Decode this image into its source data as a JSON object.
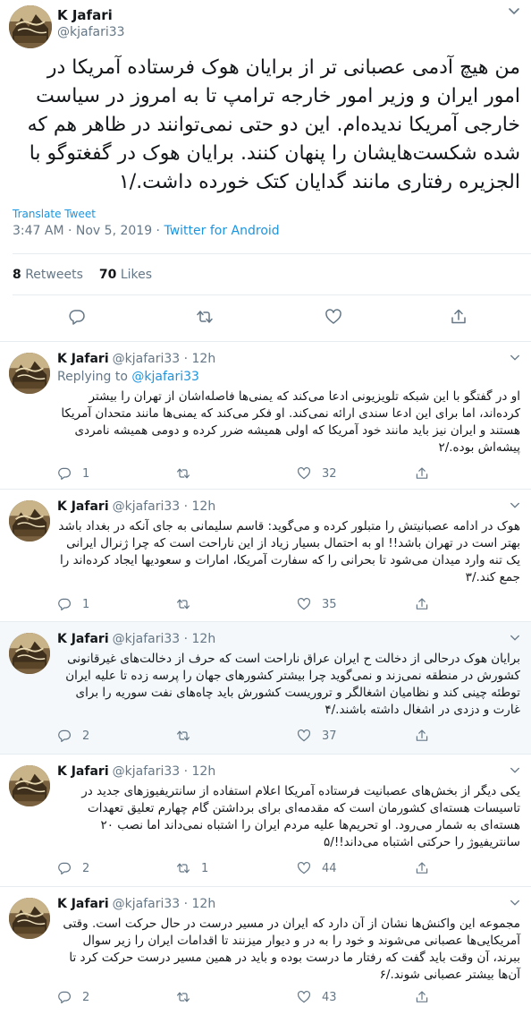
{
  "main_tweet": {
    "name": "K Jafari",
    "handle": "@kjafari33",
    "text": "من هیچ آدمی عصبانی تر از برایان هوک فرستاده آمریکا در امور ایران و وزیر امور خارجه ترامپ تا به امروز در سیاست خارجی آمریکا ندیده‌ام. این دو حتی نمی‌توانند در ظاهر هم که شده شکست‌هایشان را پنهان کنند. برایان هوک در گفغتوگو با الجزیره رفتاری مانند گدایان کتک خورده داشت./۱",
    "translate_label": "Translate Tweet",
    "time": "3:47 AM · Nov 5, 2019 · ",
    "source": "Twitter for Android",
    "retweets": {
      "count": "8",
      "label": "Retweets"
    },
    "likes": {
      "count": "70",
      "label": "Likes"
    }
  },
  "replies": [
    {
      "name": "K Jafari",
      "handle": "@kjafari33 · 12h",
      "replying_prefix": "Replying to ",
      "replying_to": "@kjafari33",
      "text": "او در گفتگو با این شبکه تلویزیونی ادعا می‌کند که یمنی‌ها فاصله‌اشان از تهران را بیشتر کرده‌اند، اما برای این ادعا سندی ارائه نمی‌کند. او فکر می‌کند که یمنی‌ها مانند متحدان آمریکا هستند و ایران نیز باید مانند خود آمریکا که اولی همیشه ضرر کرده و دومی همیشه نامردی پیشه‌اش بوده./۲",
      "reply_count": "1",
      "retweet_count": "",
      "like_count": "32"
    },
    {
      "name": "K Jafari",
      "handle": "@kjafari33 · 12h",
      "text": "هوک در ادامه عصبانیتش را متبلور کرده و می‌گوید: قاسم سلیمانی به جای آنکه در بغداد باشد بهتر است در تهران باشد!! او به احتمال بسیار زیاد از این ناراحت است که چرا ژنرال ایرانی یک تنه وارد میدان می‌شود تا بحرانی را که سفارت آمریکا، امارات و سعودیها ایجاد کرده‌اند را جمع کند./۳",
      "reply_count": "1",
      "retweet_count": "",
      "like_count": "35"
    },
    {
      "name": "K Jafari",
      "handle": "@kjafari33 · 12h",
      "text": "برایان هوک درحالی از دخالت ح ایران عراق ناراحت است که حرف از دخالت‌های غیرقانونی کشورش در منطقه نمی‌زند و نمی‌گوید چرا بیشتر کشورهای جهان را پرسه زده تا علیه ایران توطئه چینی کند و نظامیان اشغالگر و تروریست کشورش باید چاه‌های نفت سوریه را برای غارت و دزدی در اشغال داشته باشند./۴",
      "reply_count": "2",
      "retweet_count": "",
      "like_count": "37"
    },
    {
      "name": "K Jafari",
      "handle": "@kjafari33 · 12h",
      "text": "یکی دیگر از بخش‌های عصبانیت فرستاده آمریکا اعلام استفاده از سانتریفیوزهای جدید در تاسیسات هسته‌ای کشورمان است که مقدمه‌ای برای برداشتن گام چهارم تعلیق تعهدات هسته‌ای به شمار می‌رود. او تحریم‌ها علیه مردم ایران را اشتباه نمی‌داند اما نصب ۲۰ سانتریفیوژ را حرکتی اشتباه می‌داند!!/۵",
      "reply_count": "2",
      "retweet_count": "1",
      "like_count": "44"
    },
    {
      "name": "K Jafari",
      "handle": "@kjafari33 · 12h",
      "text": "مجموعه این واکنش‌ها نشان از آن دارد که ایران در مسیر درست در حال حرکت است. وقتی آمریکایی‌ها عصبانی می‌شوند و خود را به در و دیوار میزنند تا اقدامات ایران را زیر سوال ببرند، آن وقت باید گفت که رفتار ما درست بوده و باید در همین مسیر درست حرکت کرد تا آن‌ها بیشتر عصبانی شوند./۶",
      "reply_count": "2",
      "retweet_count": "",
      "like_count": "43"
    }
  ],
  "icons": {
    "avatar": "avatar-image",
    "chevron": "chevron-down-icon",
    "reply": "reply-icon",
    "retweet": "retweet-icon",
    "like": "like-icon",
    "share": "share-icon"
  },
  "colors": {
    "link": "#1b95e0",
    "muted": "#657786",
    "text": "#14171a",
    "highlight_bg": "#f5f8fa"
  }
}
